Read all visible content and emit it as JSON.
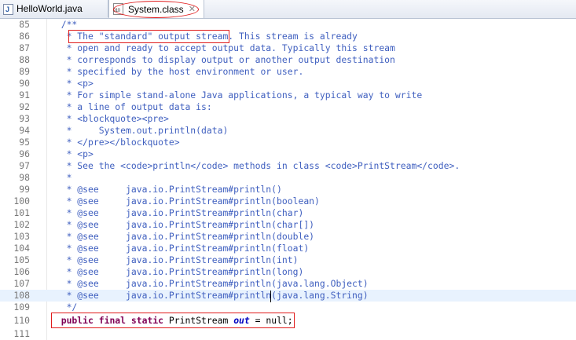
{
  "tabs": [
    {
      "label": "HelloWorld.java",
      "icon": "java-file-icon",
      "active": false
    },
    {
      "label": "System.class",
      "icon": "class-file-icon",
      "active": true,
      "close": "✕"
    }
  ],
  "class_icon_text": "010",
  "java_icon_text": "J",
  "code_lines": [
    {
      "n": "85",
      "t": "  /**"
    },
    {
      "n": "86",
      "t": "   * The \"standard\" output stream. This stream is already"
    },
    {
      "n": "87",
      "t": "   * open and ready to accept output data. Typically this stream"
    },
    {
      "n": "88",
      "t": "   * corresponds to display output or another output destination"
    },
    {
      "n": "89",
      "t": "   * specified by the host environment or user."
    },
    {
      "n": "90",
      "t": "   * <p>"
    },
    {
      "n": "91",
      "t": "   * For simple stand-alone Java applications, a typical way to write"
    },
    {
      "n": "92",
      "t": "   * a line of output data is:"
    },
    {
      "n": "93",
      "t": "   * <blockquote><pre>"
    },
    {
      "n": "94",
      "t": "   *     System.out.println(data)"
    },
    {
      "n": "95",
      "t": "   * </pre></blockquote>"
    },
    {
      "n": "96",
      "t": "   * <p>"
    },
    {
      "n": "97",
      "t": "   * See the <code>println</code> methods in class <code>PrintStream</code>."
    },
    {
      "n": "98",
      "t": "   *"
    },
    {
      "n": "99",
      "t": "   * @see     java.io.PrintStream#println()"
    },
    {
      "n": "100",
      "t": "   * @see     java.io.PrintStream#println(boolean)"
    },
    {
      "n": "101",
      "t": "   * @see     java.io.PrintStream#println(char)"
    },
    {
      "n": "102",
      "t": "   * @see     java.io.PrintStream#println(char[])"
    },
    {
      "n": "103",
      "t": "   * @see     java.io.PrintStream#println(double)"
    },
    {
      "n": "104",
      "t": "   * @see     java.io.PrintStream#println(float)"
    },
    {
      "n": "105",
      "t": "   * @see     java.io.PrintStream#println(int)"
    },
    {
      "n": "106",
      "t": "   * @see     java.io.PrintStream#println(long)"
    },
    {
      "n": "107",
      "t": "   * @see     java.io.PrintStream#println(java.lang.Object)"
    },
    {
      "n": "108",
      "t": "   * @see     java.io.PrintStream#println(java.lang.String)",
      "highlight": true
    },
    {
      "n": "109",
      "t": "   */"
    },
    {
      "n": "110",
      "t": "  public final static PrintStream out = null;"
    },
    {
      "n": "111",
      "t": ""
    }
  ],
  "decl": {
    "kw1": "public",
    "kw2": "final",
    "kw3": "static",
    "type": "PrintStream",
    "field": "out",
    "rest": " = null;"
  },
  "colors": {
    "comment": "#3f5fbf",
    "keyword": "#7f0055",
    "field": "#0000c0",
    "annotation_box": "#e01c1c",
    "line_highlight": "#e8f2fe"
  }
}
